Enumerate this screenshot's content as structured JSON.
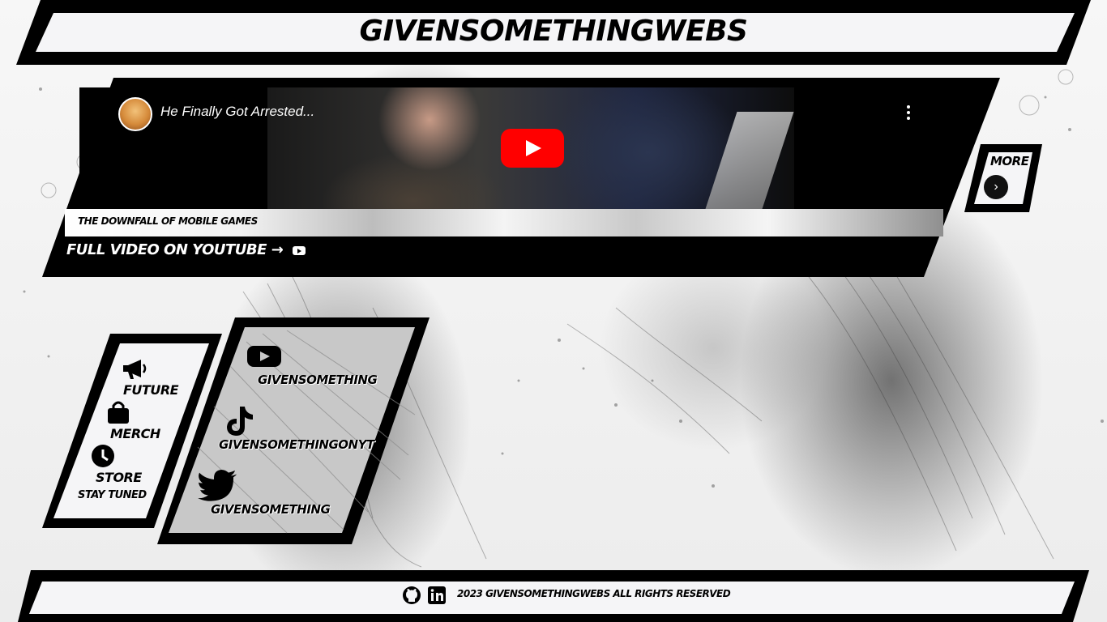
{
  "header": {
    "title": "GIVENSOMETHINGWEBS"
  },
  "video": {
    "title": "He Finally Got Arrested...",
    "caption": "THE DOWNFALL OF MOBILE GAMES",
    "full_video_label": "FULL VIDEO ON YOUTUBE",
    "arrow": "→"
  },
  "more": {
    "label": "MORE",
    "arrow": "›"
  },
  "nav": {
    "items": [
      {
        "label": "FUTURE",
        "icon": "megaphone-icon"
      },
      {
        "label": "MERCH",
        "icon": "shopping-bag-icon"
      },
      {
        "label": "STORE",
        "icon": "clock-icon",
        "note": "STAY TUNED"
      }
    ]
  },
  "social": {
    "items": [
      {
        "label": "GIVENSOMETHING",
        "icon": "youtube-icon"
      },
      {
        "label": "GIVENSOMETHINGONYT",
        "icon": "tiktok-icon"
      },
      {
        "label": "GIVENSOMETHING",
        "icon": "twitter-icon"
      }
    ]
  },
  "footer": {
    "text": "2023 GIVENSOMETHINGWEBS ALL RIGHTS RESERVED",
    "icons": [
      "github-icon",
      "linkedin-icon"
    ]
  },
  "colors": {
    "ink": "#000000",
    "panel": "#f5f5f7",
    "youtube_red": "#ff0000"
  }
}
